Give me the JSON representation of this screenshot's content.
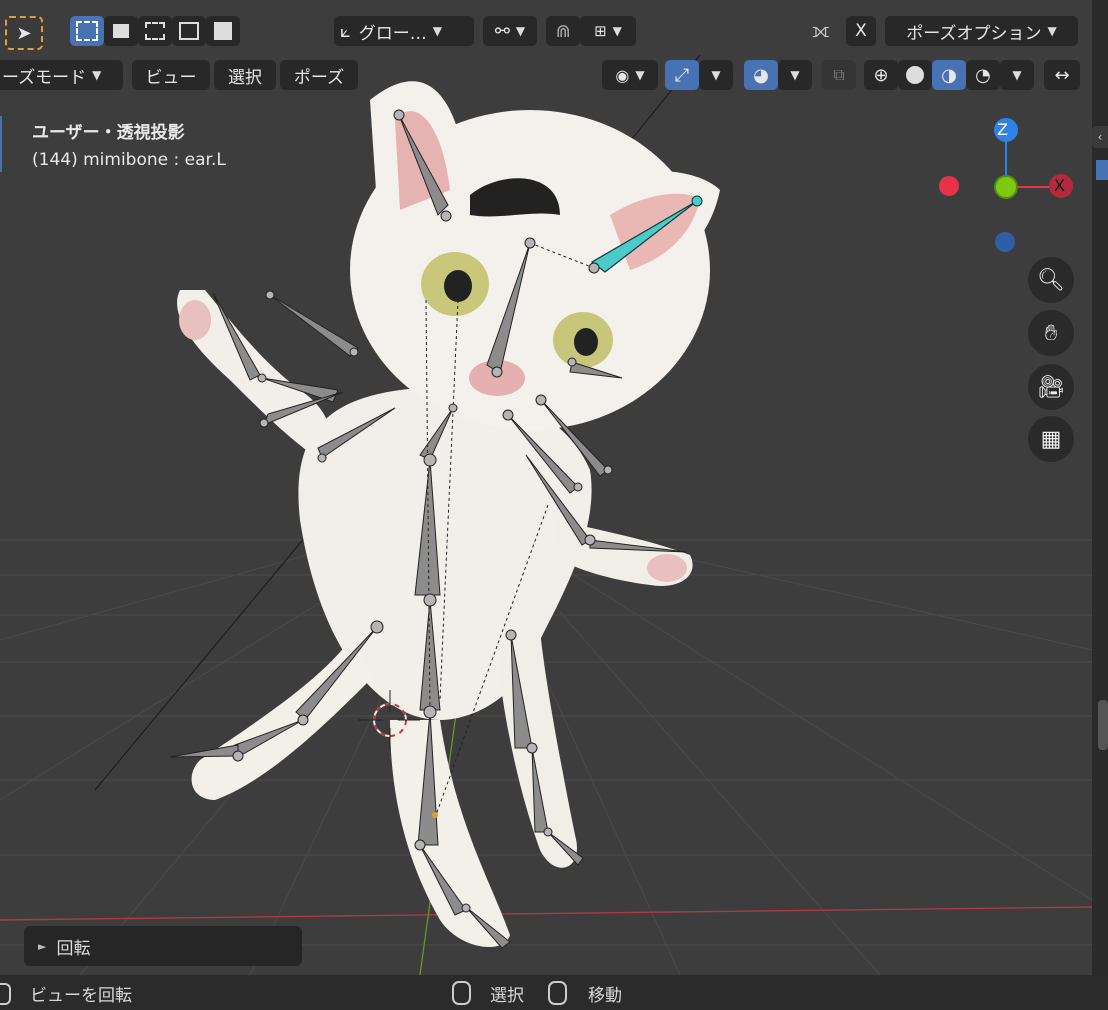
{
  "header": {
    "transform_orientation": "グロー…",
    "mirror_x": "X",
    "pose_options": "ポーズオプション",
    "mode": "ーズモード",
    "menu": {
      "view": "ビュー",
      "select": "選択",
      "pose": "ポーズ"
    }
  },
  "overlay": {
    "view_name": "ユーザー・透視投影",
    "frame_info": "(144) mimibone : ear.L"
  },
  "gizmo": {
    "z": "Z",
    "x": "X"
  },
  "last_operator": {
    "arrow": "►",
    "label": "回転"
  },
  "statusbar": {
    "rotate_view": "ビューを回転",
    "select": "選択",
    "move": "移動"
  },
  "colors": {
    "accent": "#4772b3",
    "active_bone": "#4cc9c9",
    "axis_x": "#e8324a",
    "axis_y": "#7ec810",
    "axis_z": "#2f83e6"
  },
  "icons": [
    "select-cursor-icon",
    "box-select-icon",
    "mode-new-icon",
    "mode-extend-icon",
    "mode-subtract-icon",
    "mode-intersect-icon",
    "orientation-icon",
    "pivot-icon",
    "snap-icon",
    "snap-increment-icon",
    "mirror-butterfly-icon",
    "visibility-eye-icon",
    "gizmo-icon",
    "overlay-icon",
    "xray-icon",
    "wireframe-shading-icon",
    "solid-shading-icon",
    "material-shading-icon",
    "rendered-shading-icon",
    "zoom-icon",
    "hand-pan-icon",
    "camera-icon",
    "grid-perspective-icon",
    "mouse-left-icon",
    "mouse-middle-icon"
  ]
}
